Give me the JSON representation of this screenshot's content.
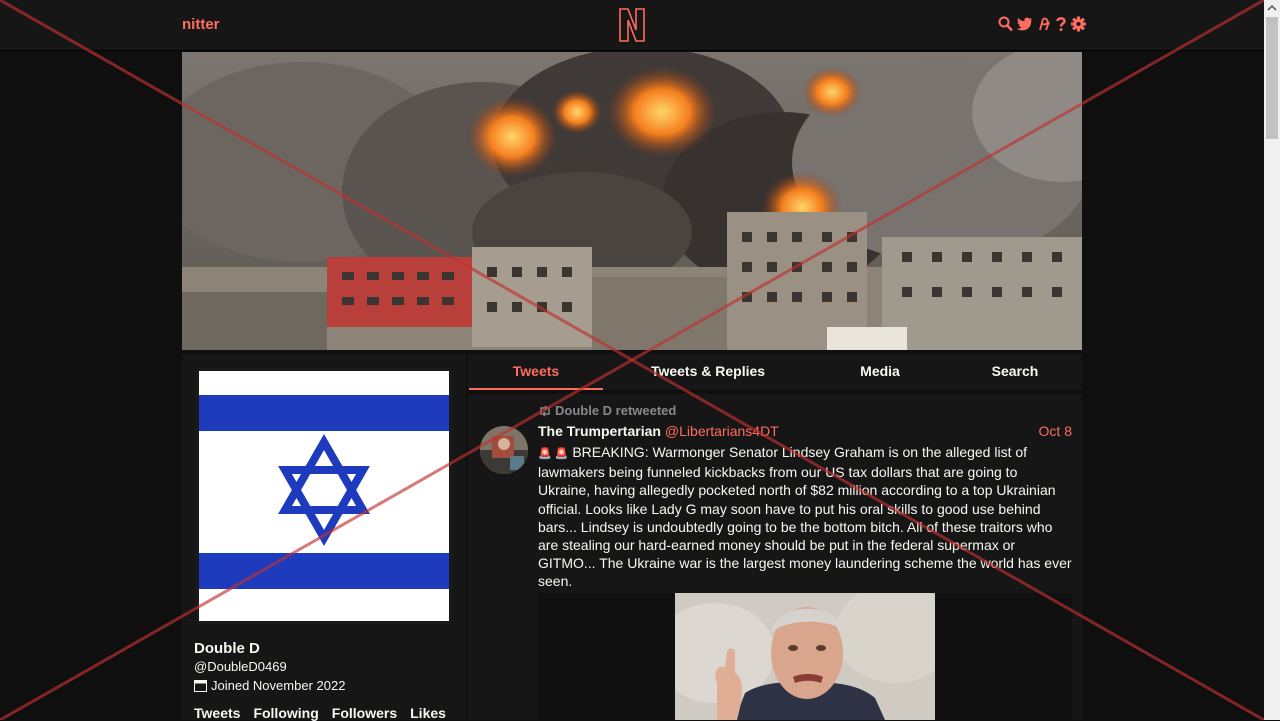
{
  "navbar": {
    "brand": "nitter",
    "icons": [
      "search-icon",
      "bird-icon",
      "rss-icon",
      "help-icon",
      "gear-icon"
    ]
  },
  "colors": {
    "accent": "#ff6c60",
    "bg": "#0f0f0f",
    "panel": "#161616",
    "text": "#f8f8f2",
    "muted": "#888889",
    "flag_blue": "#1f3bbd"
  },
  "profile": {
    "name": "Double D",
    "handle": "@DoubleD0469",
    "joined": "Joined November 2022",
    "stats": {
      "tweets": "Tweets",
      "following": "Following",
      "followers": "Followers",
      "likes": "Likes"
    }
  },
  "tabs": [
    {
      "label": "Tweets",
      "active": true
    },
    {
      "label": "Tweets & Replies",
      "active": false
    },
    {
      "label": "Media",
      "active": false
    },
    {
      "label": "Search",
      "active": false
    }
  ],
  "timeline": {
    "tweet": {
      "retweet_header": "Double D retweeted",
      "fullname": "The Trumpertarian",
      "username": "@Libertarians4DT",
      "date": "Oct 8",
      "emoji": "🚨 🚨",
      "text": "BREAKING: Warmonger Senator Lindsey Graham is on the alleged list of lawmakers being funneled kickbacks from our US tax dollars that are going to Ukraine, having allegedly pocketed north of $82 million according to a top Ukrainian official. Looks like Lady G may soon have to put his oral skills to good use behind bars... Lindsey is undoubtedly going to be the bottom bitch. All of these traitors who are stealing our hard-earned money should be put in the federal supermax or GITMO... The Ukraine war is the largest money laundering scheme the world has ever seen."
    }
  }
}
